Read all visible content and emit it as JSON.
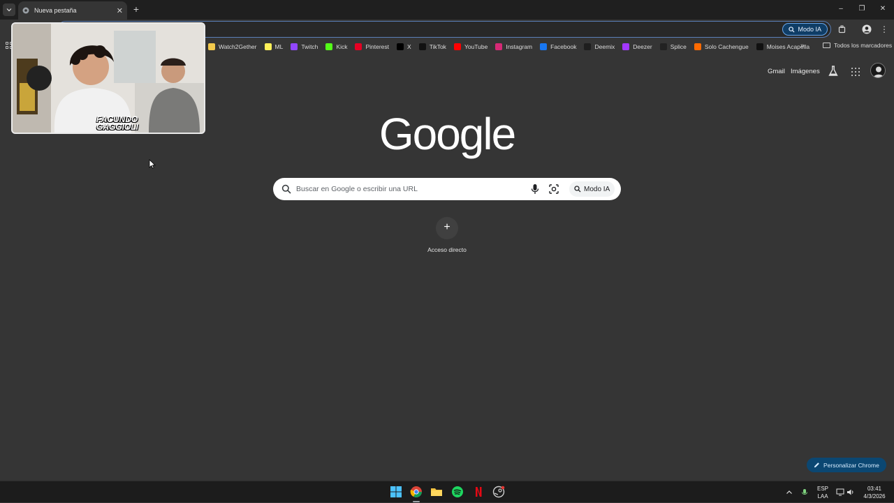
{
  "browser": {
    "tab": {
      "title": "Nueva pestaña"
    },
    "omnibox": {
      "ai_mode_label": "Modo IA"
    },
    "bookmarks": [
      {
        "label": "Watch2Gether",
        "icon": "watch2gether-icon",
        "color": "#f2c94c"
      },
      {
        "label": "ML",
        "icon": "mercadolibre-icon",
        "color": "#fff159"
      },
      {
        "label": "Twitch",
        "icon": "twitch-icon",
        "color": "#9146ff"
      },
      {
        "label": "Kick",
        "icon": "kick-icon",
        "color": "#53fc18"
      },
      {
        "label": "Pinterest",
        "icon": "pinterest-icon",
        "color": "#e60023"
      },
      {
        "label": "X",
        "icon": "x-icon",
        "color": "#000000"
      },
      {
        "label": "TikTok",
        "icon": "tiktok-icon",
        "color": "#111111"
      },
      {
        "label": "YouTube",
        "icon": "youtube-icon",
        "color": "#ff0000"
      },
      {
        "label": "Instagram",
        "icon": "instagram-icon",
        "color": "#d62976"
      },
      {
        "label": "Facebook",
        "icon": "facebook-icon",
        "color": "#1877f2"
      },
      {
        "label": "Deemix",
        "icon": "deemix-icon",
        "color": "#1e1e1e"
      },
      {
        "label": "Deezer",
        "icon": "deezer-icon",
        "color": "#a238ff"
      },
      {
        "label": "Splice",
        "icon": "splice-icon",
        "color": "#222222"
      },
      {
        "label": "Solo Cachengue",
        "icon": "flame-icon",
        "color": "#ff6a00"
      },
      {
        "label": "Moises Acapella",
        "icon": "moises-icon",
        "color": "#111111"
      }
    ],
    "all_bookmarks_label": "Todos los marcadores"
  },
  "newtab": {
    "links": {
      "gmail": "Gmail",
      "images": "Imágenes"
    },
    "logo_text": "Google",
    "search": {
      "placeholder": "Buscar en Google o escribir una URL",
      "ai_mode_label": "Modo IA"
    },
    "shortcut": {
      "label": "Acceso directo"
    },
    "customize_label": "Personalizar Chrome"
  },
  "overlay": {
    "webcam_text_line1": "FACUNDO",
    "webcam_text_line2": "GAGGIOLI"
  },
  "taskbar": {
    "apps": [
      "windows-start-icon",
      "chrome-icon",
      "file-explorer-icon",
      "spotify-icon",
      "netflix-icon",
      "steam-icon"
    ],
    "lang_line1": "ESP",
    "lang_line2": "LAA",
    "time": "03:41",
    "date": "4/3/2026"
  },
  "colors": {
    "accent": "#0b4772",
    "page_bg": "#353535",
    "titlebar_bg": "#1f1f1f"
  }
}
